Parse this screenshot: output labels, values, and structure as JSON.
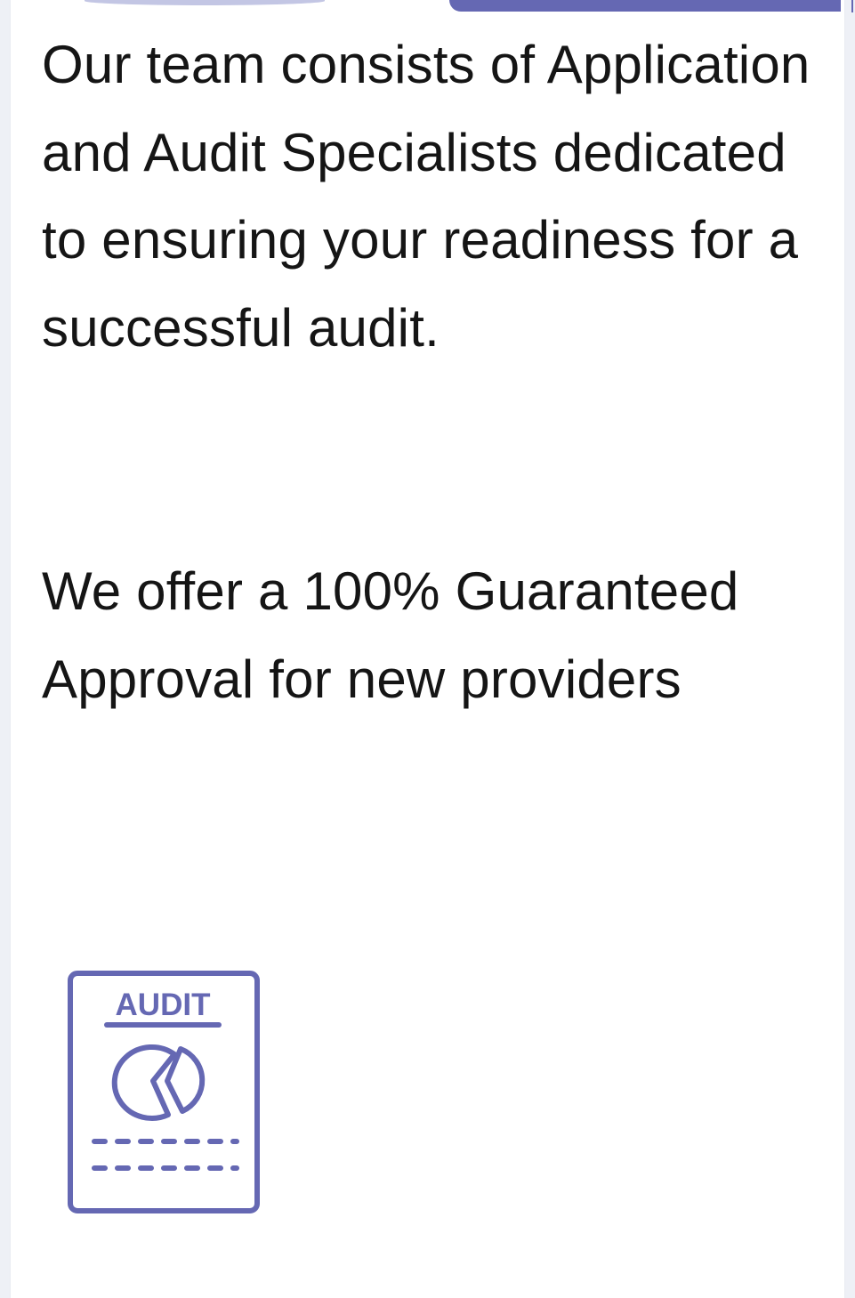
{
  "content": {
    "intro_text": "Our team consists of Application and Audit Specialists dedicated to ensuring your readiness for a successful audit.",
    "offer_text": "We offer a 100% Guaranteed Approval for new providers"
  },
  "icon": {
    "name": "audit-document-icon",
    "label": "AUDIT",
    "color": "#6568b3"
  },
  "colors": {
    "accent": "#6568b3",
    "accent_light": "#c3c6e4",
    "text": "#151515",
    "background": "#ffffff"
  }
}
